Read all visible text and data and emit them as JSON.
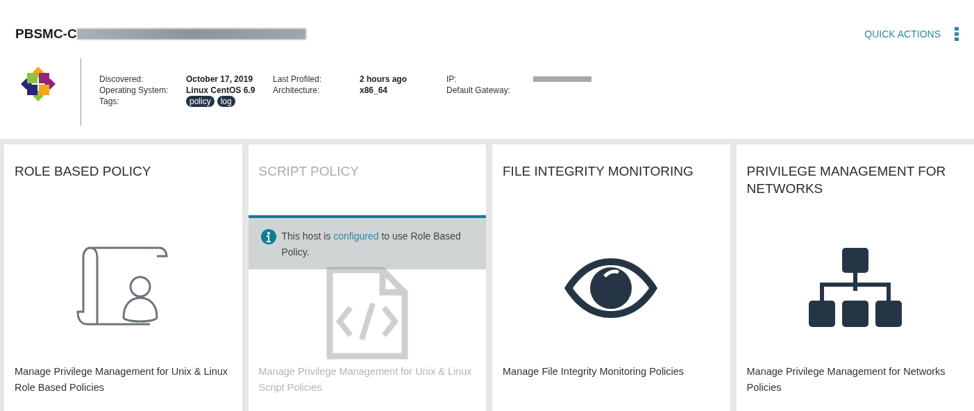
{
  "host": {
    "title": "PBSMC-C",
    "quick_actions": "QUICK ACTIONS",
    "fields": [
      {
        "label": "Discovered:",
        "value": "October 17, 2019"
      },
      {
        "label": "Operating System:",
        "value": "Linux CentOS 6.9"
      },
      {
        "label": "Tags:",
        "tags": [
          "policy",
          "log"
        ]
      },
      {
        "label": "Last Profiled:",
        "value": "2 hours ago"
      },
      {
        "label": "Architecture:",
        "value": "x86_64"
      },
      {
        "label": "IP:",
        "redacted": true
      },
      {
        "label": "Default Gateway:"
      }
    ]
  },
  "cards": [
    {
      "kind": "scroll",
      "title": "ROLE BASED POLICY",
      "disabled": false,
      "description": "Manage Privilege Management for Unix & Linux Role Based Policies"
    },
    {
      "kind": "code",
      "title": "SCRIPT POLICY",
      "disabled": true,
      "notice": {
        "before": "This host is ",
        "link": "configured",
        "after": " to use Role Based Policy."
      },
      "description": "Manage Privilege Management for Unix & Linux Script Policies"
    },
    {
      "kind": "eye",
      "title": "FILE INTEGRITY MONITORING",
      "disabled": false,
      "description": "Manage File Integrity Monitoring Policies"
    },
    {
      "kind": "network",
      "title": "PRIVILEGE MANAGEMENT FOR NETWORKS",
      "disabled": false,
      "description": "Manage Privilege Management for Networks Policies"
    }
  ]
}
